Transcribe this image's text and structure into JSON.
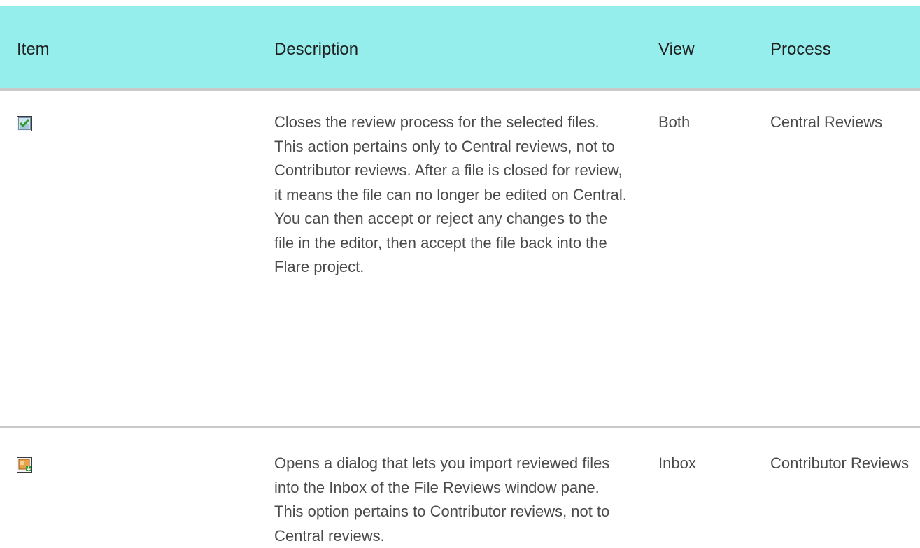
{
  "header": {
    "item": "Item",
    "description": "Description",
    "view": "View",
    "process": "Process"
  },
  "rows": [
    {
      "icon": "close-review-icon",
      "description": "Closes the review process for the selected files. This action pertains only to Central reviews, not to Contributor reviews. After a file is closed for review, it means the file can no longer be edited on Central. You can then accept or reject any changes to the file in the editor, then accept the file back into the Flare project.",
      "view": "Both",
      "process": "Central Reviews"
    },
    {
      "icon": "import-reviewed-files-icon",
      "description": "Opens a dialog that lets you import reviewed files into the Inbox of the File Reviews window pane. This option pertains to Contributor reviews, not to Central reviews.",
      "view": "Inbox",
      "process": "Contributor Reviews"
    }
  ]
}
